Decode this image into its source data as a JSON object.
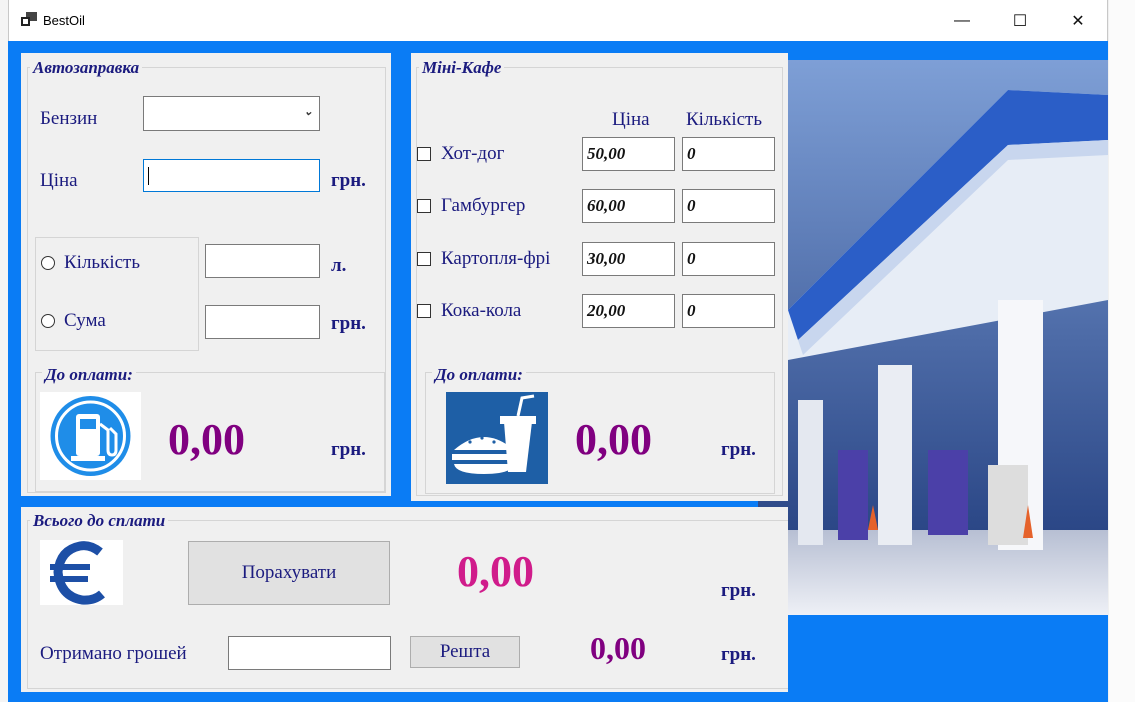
{
  "window": {
    "title": "BestOil"
  },
  "controls": {
    "minimize": "—",
    "maximize": "☐",
    "close": "✕"
  },
  "fuel": {
    "legend": "Автозаправка",
    "petrol_label": "Бензин",
    "petrol_value": "",
    "price_label": "Ціна",
    "price_value": "",
    "price_unit": "грн.",
    "quantity_label": "Кількість",
    "quantity_value": "",
    "quantity_unit": "л.",
    "sum_label": "Сума",
    "sum_value": "",
    "sum_unit": "грн.",
    "pay_legend": "До оплати:",
    "pay_value": "0,00",
    "pay_unit": "грн.",
    "icon": "fuel-pump-icon"
  },
  "cafe": {
    "legend": "Міні-Кафе",
    "price_header": "Ціна",
    "quantity_header": "Кількість",
    "items": [
      {
        "name": "Хот-дог",
        "price": "50,00",
        "quantity": "0"
      },
      {
        "name": "Гамбургер",
        "price": "60,00",
        "quantity": "0"
      },
      {
        "name": "Картопля-фрі",
        "price": "30,00",
        "quantity": "0"
      },
      {
        "name": "Кока-кола",
        "price": "20,00",
        "quantity": "0"
      }
    ],
    "pay_legend": "До оплати:",
    "pay_value": "0,00",
    "pay_unit": "грн.",
    "icon": "fast-food-icon"
  },
  "total": {
    "legend": "Всього до сплати",
    "calculate_label": "Порахувати",
    "total_value": "0,00",
    "total_unit": "грн.",
    "received_label": "Отримано грошей",
    "received_value": "",
    "change_label": "Решта",
    "change_value": "0,00",
    "change_unit": "грн.",
    "icon": "euro-icon"
  },
  "photo": {
    "icon": "gas-station-photo"
  },
  "colors": {
    "accent": "#0a7cf5",
    "label": "#1b1b7f",
    "value": "#800080",
    "total": "#d01c8b"
  }
}
